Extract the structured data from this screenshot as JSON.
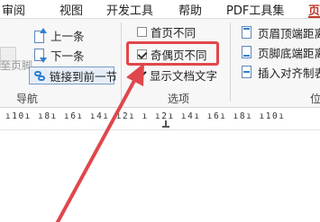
{
  "tabs": [
    {
      "label": "审阅"
    },
    {
      "label": "视图"
    },
    {
      "label": "开发工具"
    },
    {
      "label": "帮助"
    },
    {
      "label": "PDF工具集"
    },
    {
      "label": "页"
    }
  ],
  "nav_group": {
    "label": "导航",
    "ghost_label": "至页脚",
    "prev_label": "上一条",
    "next_label": "下一条",
    "link_label": "链接到前一节"
  },
  "options_group": {
    "label": "选项",
    "first_page_label": "首页不同",
    "odd_even_label": "奇偶页不同",
    "odd_even_checked": true,
    "show_text_label": "显示文档文字",
    "show_text_checked": true
  },
  "position_group": {
    "label": "位",
    "header_top_label": "页眉顶端距离",
    "footer_bottom_label": "页脚底端距离",
    "insert_align_label": "插入对齐制表"
  },
  "ruler": {
    "text": "ı10ı ı8ı ı6ı ı4ı ı2ı ı ı2ı ı4ı ı6ı ı8ı ı10ı"
  },
  "colors": {
    "accent": "#c0392b",
    "highlight": "#e0474c",
    "icon_blue": "#2f80d1"
  }
}
